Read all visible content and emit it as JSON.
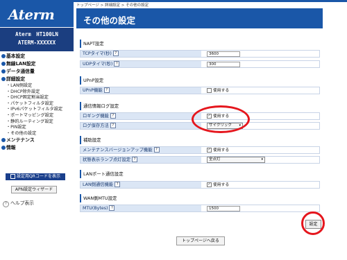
{
  "sidebar": {
    "logo": "Aterm",
    "model_line1": "Aterm　HT100LN",
    "model_line2": "ATERM-XXXXXX",
    "nav": [
      {
        "label": "基本設定",
        "type": "top"
      },
      {
        "label": "無線LAN設定",
        "type": "top"
      },
      {
        "label": "データ通信量",
        "type": "top"
      },
      {
        "label": "詳細設定",
        "type": "top"
      },
      {
        "label": "・LAN側設定",
        "type": "sub"
      },
      {
        "label": "・DHCP除外設定",
        "type": "sub"
      },
      {
        "label": "・DHCP固定割当設定",
        "type": "sub"
      },
      {
        "label": "・パケットフィルタ設定",
        "type": "sub"
      },
      {
        "label": "・IPv6パケットフィルタ設定",
        "type": "sub"
      },
      {
        "label": "・ポートマッピング設定",
        "type": "sub"
      },
      {
        "label": "・静的ルーティング設定",
        "type": "sub"
      },
      {
        "label": "・PIN設定",
        "type": "sub"
      },
      {
        "label": "・その他の設定",
        "type": "sub"
      },
      {
        "label": "メンテナンス",
        "type": "top"
      },
      {
        "label": "情報",
        "type": "top"
      }
    ],
    "qr_button": "設定用QRコードを表示",
    "apn_button": "APN設定ウィザード",
    "help": "ヘルプ表示"
  },
  "main": {
    "breadcrumb": "トップページ > 詳細設定 > その他の設定",
    "title": "その他の設定",
    "napt": {
      "section": "NAPT設定",
      "tcp_label": "TCPタイマ(秒)",
      "tcp_value": "3600",
      "udp_label": "UDPタイマ(秒)",
      "udp_value": "300"
    },
    "upnp": {
      "section": "UPnP設定",
      "label": "UPnP機能",
      "option": "使用する",
      "checked": false
    },
    "log": {
      "section": "通信情報ログ設定",
      "logging_label": "ロギング機能",
      "logging_option": "使用する",
      "logging_checked": true,
      "method_label": "ログ保存方法",
      "method_value": "サイクリック"
    },
    "assist": {
      "section": "補助設定",
      "maint_label": "メンテナンスバージョンアップ機能",
      "maint_option": "使用する",
      "maint_checked": true,
      "lamp_label": "状態表示ランプ点灯設定",
      "lamp_value": "全点灯"
    },
    "lan_port": {
      "section": "LANポート通信設定",
      "label": "LAN側通信機能",
      "option": "使用する",
      "checked": true
    },
    "wan_mtu": {
      "section": "WAN側MTU設定",
      "label": "MTU(Bytes)",
      "value": "1500"
    },
    "set_button": "設定",
    "top_button": "トップページへ戻る",
    "help_mark": "?",
    "check_mark": "✓",
    "select_arrow": "▾"
  },
  "colors": {
    "primary": "#1a57a8",
    "dark_navy": "#1b3e80",
    "label_bg": "#dbe6f5",
    "highlight": "#e5161d"
  }
}
